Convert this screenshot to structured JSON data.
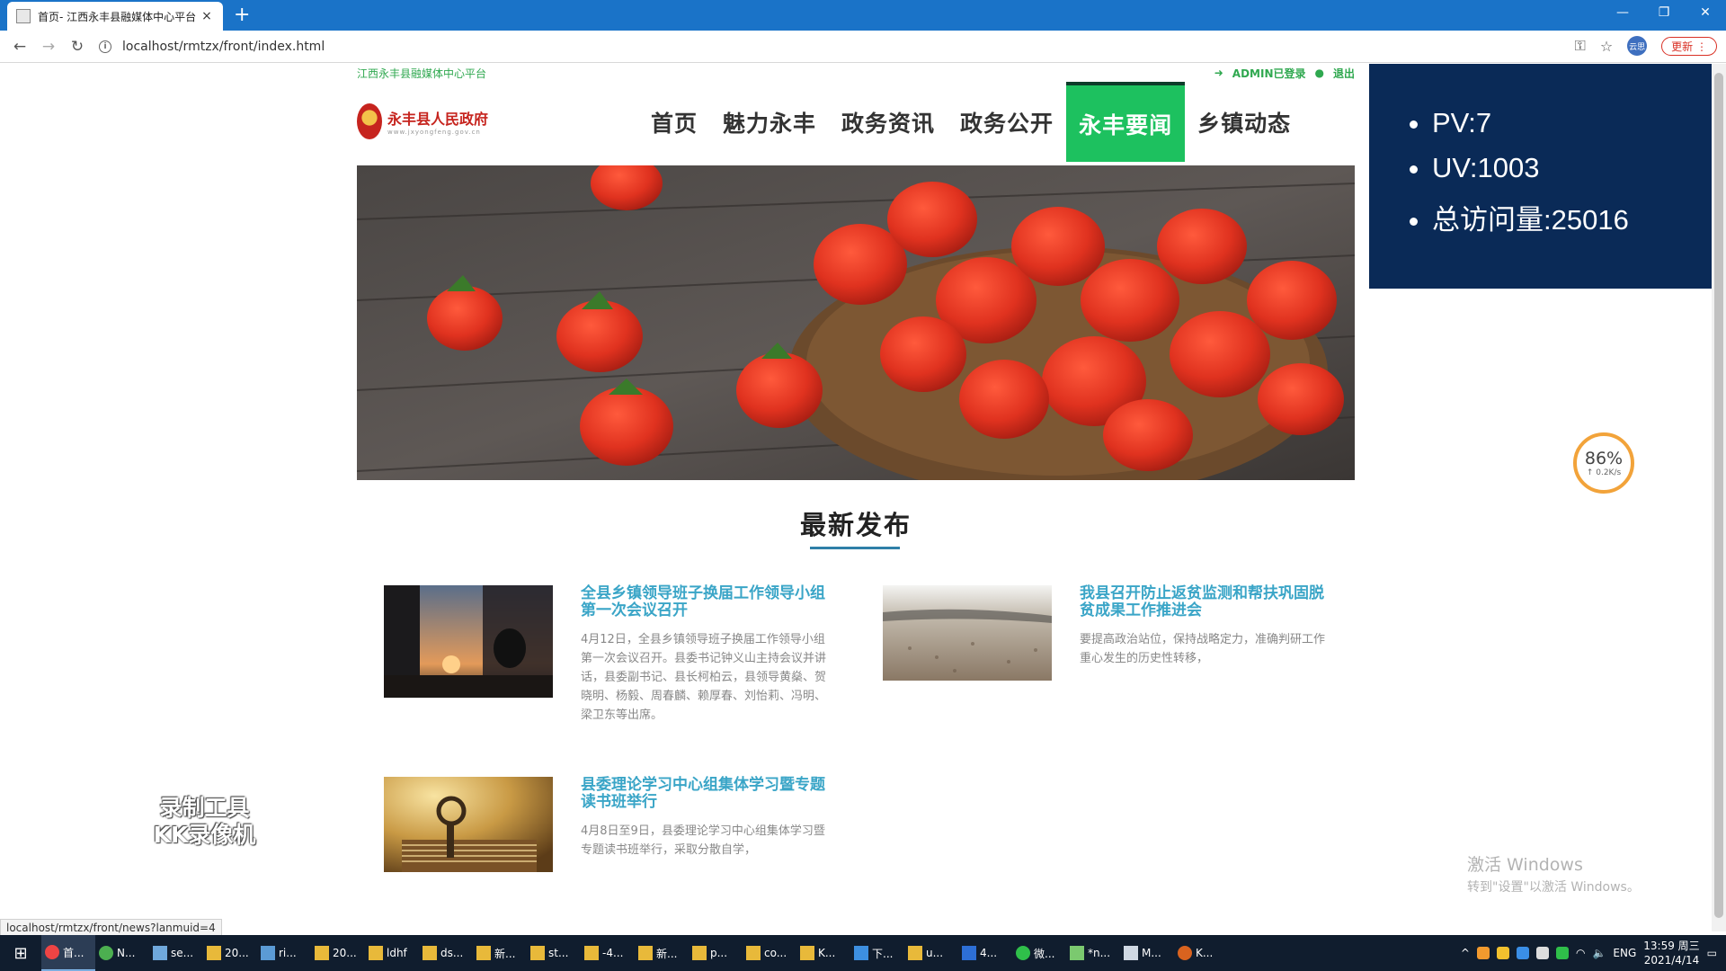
{
  "browser": {
    "tab_title": "首页- 江西永丰县融媒体中心平台",
    "tab_close": "×",
    "new_tab": "+",
    "url": "localhost/rmtzx/front/index.html",
    "update_label": "更新",
    "profile_label": "云思",
    "status_url": "localhost/rmtzx/front/news?lanmuid=4",
    "window_controls": [
      "—",
      "❐",
      "✕"
    ],
    "icons": [
      "back-icon",
      "forward-icon",
      "reload-icon",
      "info-icon",
      "key-icon",
      "star-icon",
      "menu-icon"
    ]
  },
  "site": {
    "tagline": "江西永丰县融媒体中心平台",
    "login_status": "ADMIN已登录",
    "logout": "退出",
    "logo_name": "永丰县人民政府",
    "logo_sub": "www.jxyongfeng.gov.cn"
  },
  "nav": [
    {
      "label": "首页",
      "active": false
    },
    {
      "label": "魅力永丰",
      "active": false
    },
    {
      "label": "政务资讯",
      "active": false
    },
    {
      "label": "政务公开",
      "active": false
    },
    {
      "label": "永丰要闻",
      "active": true
    },
    {
      "label": "乡镇动态",
      "active": false
    }
  ],
  "section": {
    "title": "最新发布"
  },
  "news": [
    {
      "title": "全县乡镇领导班子换届工作领导小组第一次会议召开",
      "desc": "4月12日，全县乡镇领导班子换届工作领导小组第一次会议召开。县委书记钟义山主持会议并讲话，县委副书记、县长柯柏云，县领导黄燊、贺晓明、杨毅、周春麟、赖厚春、刘怡莉、冯明、梁卫东等出席。"
    },
    {
      "title": "我县召开防止返贫监测和帮扶巩固脱贫成果工作推进会",
      "desc": "要提高政治站位，保持战略定力，准确判研工作重心发生的历史性转移，"
    },
    {
      "title": "县委理论学习中心组集体学习暨专题读书班举行",
      "desc": "4月8日至9日，县委理论学习中心组集体学习暨专题读书班举行，采取分散自学，"
    }
  ],
  "stats": {
    "pv": "PV:7",
    "uv": "UV:1003",
    "total": "总访问量:25016"
  },
  "speed_widget": {
    "percent": "86%",
    "rate": "↑ 0.2K/s"
  },
  "watermark": {
    "line1": "录制工具",
    "line2": "KK录像机"
  },
  "activation": {
    "line1": "激活 Windows",
    "line2": "转到\"设置\"以激活 Windows。"
  },
  "taskbar": {
    "items": [
      "首...",
      "N...",
      "se...",
      "20...",
      "ri...",
      "20...",
      "ldhf",
      "ds...",
      "新...",
      "st...",
      "-4...",
      "新...",
      "p...",
      "co...",
      "K...",
      "下...",
      "u...",
      "4...",
      "微...",
      "*n...",
      "M...",
      "K..."
    ],
    "lang": "ENG",
    "time": "13:59 周三",
    "date": "2021/4/14"
  },
  "colors": {
    "nav_active": "#1dc15f",
    "news_title": "#3aa5c7",
    "stats_bg": "#0a2a57",
    "tagline": "#2fa84f"
  }
}
